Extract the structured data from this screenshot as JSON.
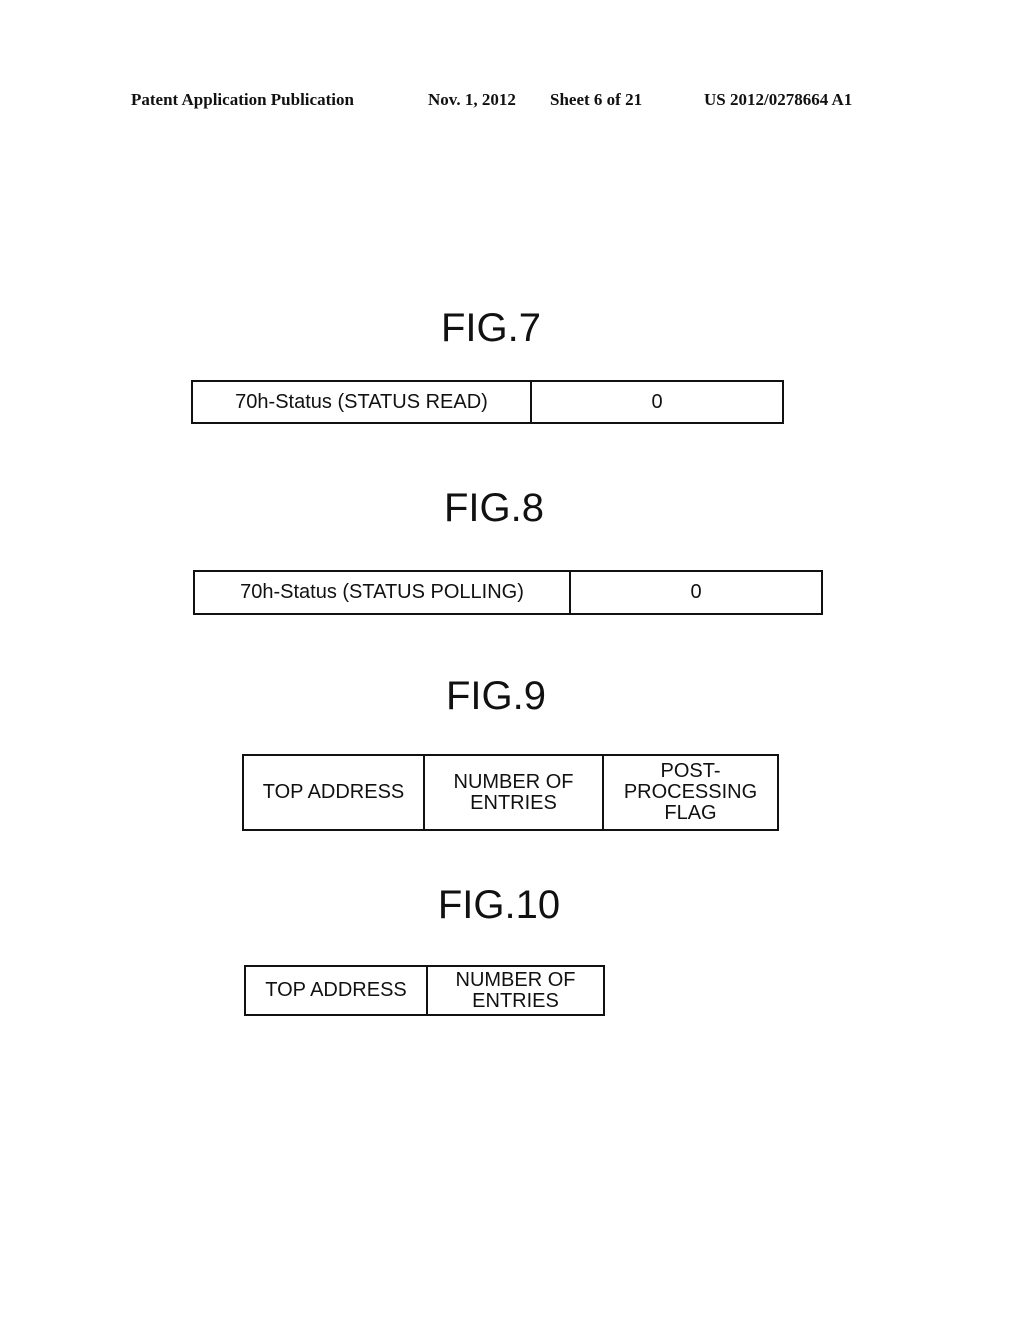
{
  "header": {
    "publication": "Patent Application Publication",
    "date": "Nov. 1, 2012",
    "sheet": "Sheet 6 of 21",
    "number": "US 2012/0278664 A1"
  },
  "figures": [
    {
      "title": "FIG.7",
      "cells": [
        "70h-Status (STATUS READ)",
        "0"
      ]
    },
    {
      "title": "FIG.8",
      "cells": [
        "70h-Status (STATUS POLLING)",
        "0"
      ]
    },
    {
      "title": "FIG.9",
      "cells": [
        "TOP ADDRESS",
        "NUMBER OF\nENTRIES",
        "POST-\nPROCESSING\nFLAG"
      ]
    },
    {
      "title": "FIG.10",
      "cells": [
        "TOP ADDRESS",
        "NUMBER OF\nENTRIES"
      ]
    }
  ]
}
